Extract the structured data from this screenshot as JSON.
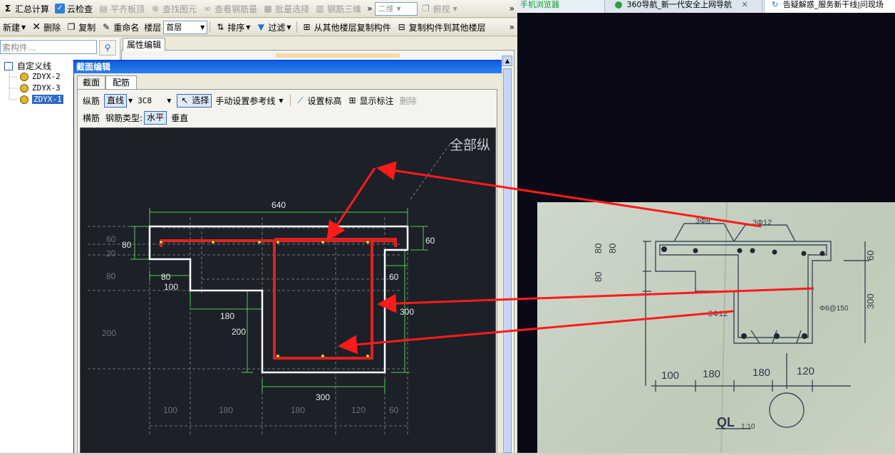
{
  "toolbar1": {
    "sum": "汇总计算",
    "cloud_check": "云检查",
    "align_slab": "平齐板顶",
    "find_element": "查找图元",
    "view_rebar_qty": "查看钢筋量",
    "batch_select": "批量选择",
    "rebar_3d": "钢筋三维",
    "overflow": "»",
    "view_2d": "二维",
    "view_top": "俯视",
    "overflow2": "»"
  },
  "toolbar2": {
    "new": "新建",
    "delete": "删除",
    "copy": "复制",
    "rename": "重命名",
    "floor_label": "楼层",
    "floor_value": "首层",
    "sort": "排序",
    "filter": "过滤",
    "copy_from": "从其他楼层复制构件",
    "copy_to": "复制构件到其他楼层",
    "overflow": "»"
  },
  "tree": {
    "search_placeholder": "索构件...",
    "root": "自定义线",
    "items": [
      "ZDYX-2",
      "ZDYX-3",
      "ZDYX-1"
    ],
    "selected_index": 2
  },
  "prop_tab": "属性编辑",
  "dialog": {
    "title": "截面编辑",
    "tabs": [
      "截面",
      "配筋"
    ],
    "active_tab": 1,
    "row1": {
      "longitudinal": "纵筋",
      "line_type": "直线",
      "rebar_spec": "3C8",
      "select": "选择",
      "manual_ref": "手动设置参考线",
      "set_elev": "设置标高",
      "show_dim": "显示标注",
      "delete": "删除"
    },
    "row2": {
      "transverse": "横筋",
      "rebar_type": "钢筋类型:",
      "horizontal": "水平",
      "vertical": "垂直"
    }
  },
  "drawing": {
    "title": "全部纵",
    "dims": {
      "top_width": "640",
      "left_height": "80",
      "right_height": "60",
      "gray_60": "60",
      "gray_20": "20",
      "gray_80": "80",
      "step_80": "80",
      "step_100": "100",
      "step_60": "60",
      "web_300_v": "300",
      "d180": "180",
      "d200": "200",
      "gray_200": "200",
      "bottom_300": "300",
      "b100": "100",
      "b180a": "180",
      "b180b": "180",
      "b120": "120",
      "b60": "60"
    }
  },
  "browser": {
    "tabs": [
      "手机浏览器",
      "360导航_新一代安全上网导航",
      "告疑解惑_服务新干线|问现场"
    ],
    "photo_labels": {
      "top_left": "3Φ8",
      "top_right": "3Φ12",
      "left_80a": "80",
      "left_80b": "80",
      "left_80c": "80",
      "right_60": "60",
      "right_300": "300",
      "stirrup": "Φ6@150",
      "mid_bar": "3Φ12",
      "b100": "100",
      "b180a": "180",
      "b180b": "180",
      "b120": "120",
      "name": "QL",
      "scale": "1:10"
    }
  },
  "colors": {
    "rebar_red": "#e02020",
    "section_white": "#ffffff",
    "dim_green": "#4fd04f",
    "arrow_red": "#ff1a1a",
    "canvas_bg": "#1c2028",
    "title_blue": "#0a5fd8"
  }
}
